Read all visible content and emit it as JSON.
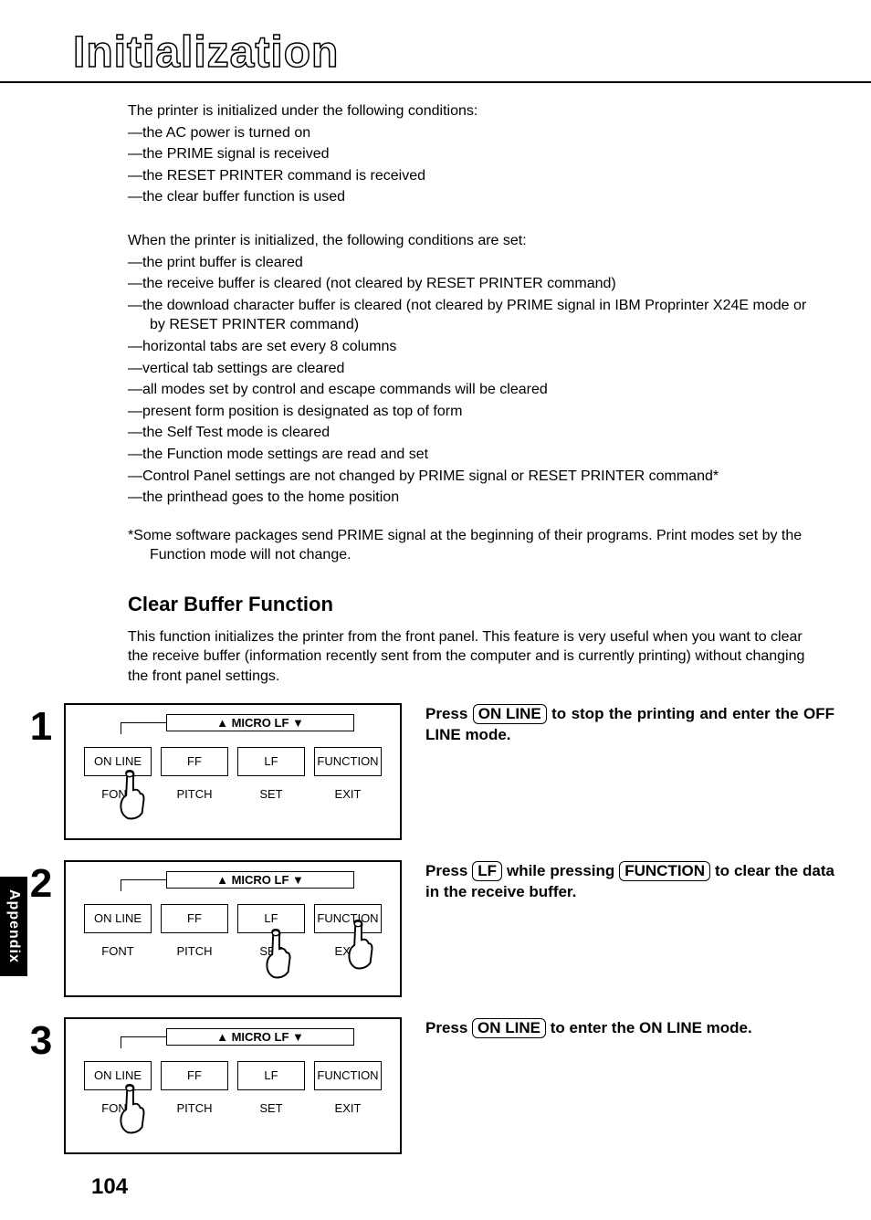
{
  "title": "Initialization",
  "intro_lead": "The printer is initialized under the following conditions:",
  "intro_items": [
    "—the AC power is turned on",
    "—the PRIME signal is received",
    "—the RESET PRINTER command is received",
    "—the clear buffer function is used"
  ],
  "init_lead": "When the printer is initialized, the following conditions are set:",
  "init_items": [
    "—the print buffer is cleared",
    "—the receive buffer is cleared (not cleared by RESET PRINTER command)",
    "—the download character buffer is cleared (not cleared by PRIME signal in IBM Proprinter X24E mode or by RESET PRINTER command)",
    "—horizontal tabs are set every 8 columns",
    "—vertical tab settings are cleared",
    "—all modes set by control and escape commands will be cleared",
    "—present form position is designated as top of form",
    "—the Self Test mode is cleared",
    "—the Function mode settings are read and set",
    "—Control Panel settings are not changed by PRIME signal or RESET PRINTER command*",
    "—the printhead goes to the home position"
  ],
  "footnote": "*Some software packages send PRIME signal at the beginning of their programs. Print modes set by the Function mode will not change.",
  "section_heading": "Clear Buffer Function",
  "section_body": "This function initializes the printer from the front panel. This feature is very useful when you want to clear the receive buffer (information recently sent from the computer and is currently printing) without changing the front panel settings.",
  "panel": {
    "micro": "▲ MICRO LF ▼",
    "buttons": [
      "ON LINE",
      "FF",
      "LF",
      "FUNCTION"
    ],
    "labels": [
      "FONT",
      "PITCH",
      "SET",
      "EXIT"
    ]
  },
  "steps": [
    {
      "num": "1",
      "text_parts": [
        "Press ",
        "ON LINE",
        " to stop the print­ing and enter the OFF LINE mode."
      ]
    },
    {
      "num": "2",
      "text_parts": [
        "Press ",
        "LF",
        " while pressing ",
        "FUNCTION",
        " to clear the data in the receive buffer."
      ]
    },
    {
      "num": "3",
      "text_parts": [
        "Press ",
        "ON LINE",
        " to enter the ON LINE mode."
      ]
    }
  ],
  "side_tab": "Appendix",
  "page_number": "104"
}
